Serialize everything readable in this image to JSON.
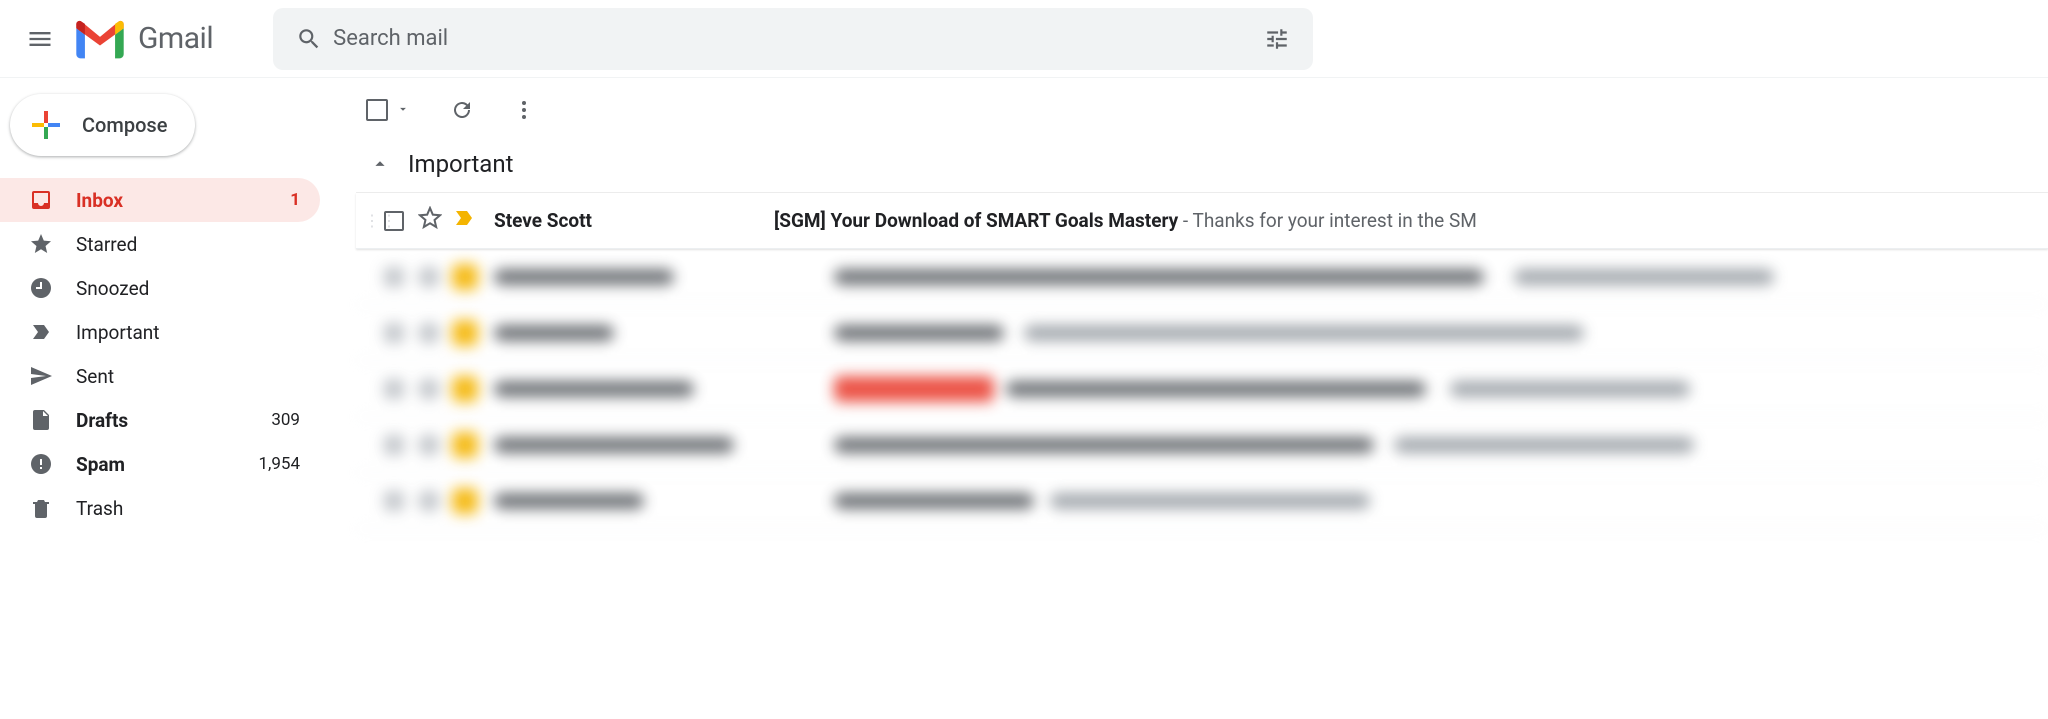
{
  "app_name": "Gmail",
  "search": {
    "placeholder": "Search mail"
  },
  "compose_label": "Compose",
  "sidebar": {
    "items": [
      {
        "label": "Inbox",
        "count": "1",
        "icon": "inbox",
        "active": true,
        "bold": true
      },
      {
        "label": "Starred",
        "count": "",
        "icon": "star",
        "active": false,
        "bold": false
      },
      {
        "label": "Snoozed",
        "count": "",
        "icon": "clock",
        "active": false,
        "bold": false
      },
      {
        "label": "Important",
        "count": "",
        "icon": "important",
        "active": false,
        "bold": false
      },
      {
        "label": "Sent",
        "count": "",
        "icon": "sent",
        "active": false,
        "bold": false
      },
      {
        "label": "Drafts",
        "count": "309",
        "icon": "drafts",
        "active": false,
        "bold": true
      },
      {
        "label": "Spam",
        "count": "1,954",
        "icon": "spam",
        "active": false,
        "bold": true
      },
      {
        "label": "Trash",
        "count": "",
        "icon": "trash",
        "active": false,
        "bold": false
      }
    ]
  },
  "section_title": "Important",
  "emails": [
    {
      "sender": "Steve Scott",
      "subject": "[SGM] Your Download of SMART Goals Mastery",
      "snippet": " - Thanks for your interest in the SM",
      "important": true,
      "starred": false
    }
  ],
  "blurred_rows": 5
}
